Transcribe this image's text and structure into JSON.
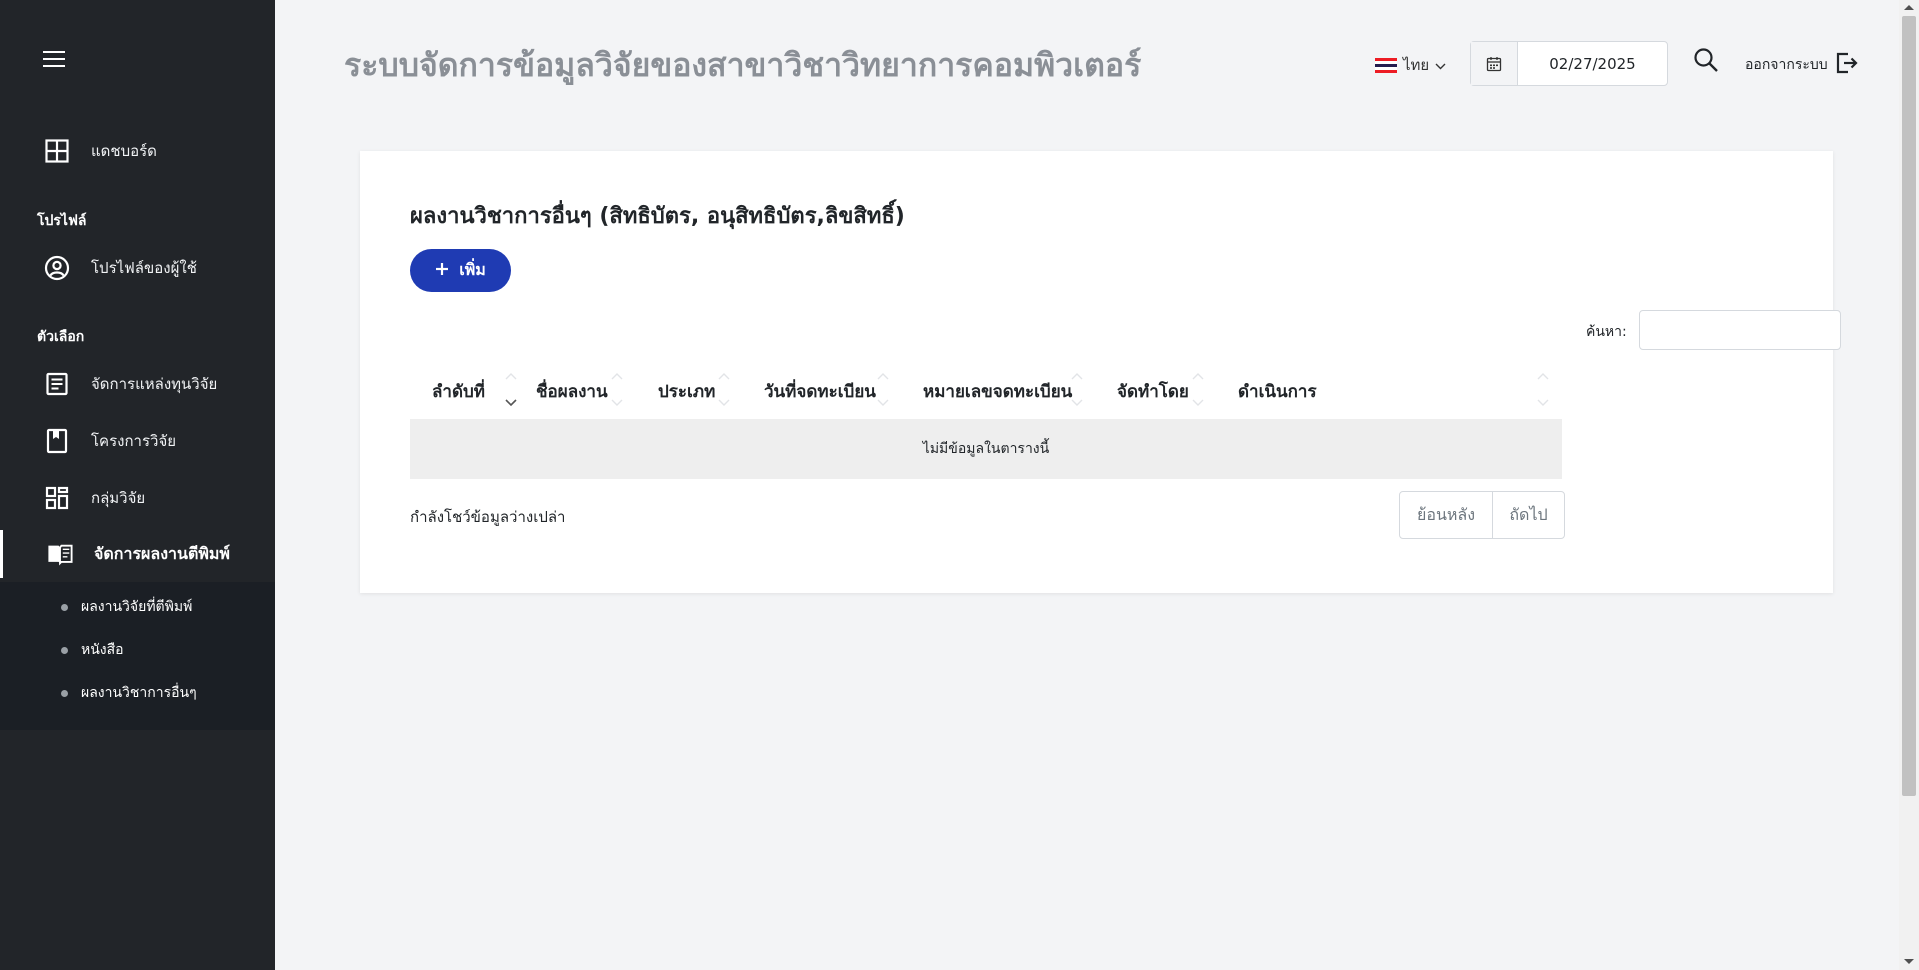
{
  "app": {
    "title": "ระบบจัดการข้อมูลวิจัยของสาขาวิชาวิทยาการคอมพิวเตอร์"
  },
  "header": {
    "language": "ไทย",
    "date": "02/27/2025",
    "logout_label": "ออกจากระบบ"
  },
  "sidebar": {
    "dashboard": "แดชบอร์ด",
    "section_profile": "โปรไฟล์",
    "user_profile": "โปรไฟล์ของผู้ใช้",
    "section_options": "ตัวเลือก",
    "items": [
      {
        "label": "จัดการแหล่งทุนวิจัย",
        "icon": "document-icon"
      },
      {
        "label": "โครงการวิจัย",
        "icon": "book-icon"
      },
      {
        "label": "กลุ่มวิจัย",
        "icon": "grid-icon"
      },
      {
        "label": "จัดการผลงานตีพิมพ์",
        "icon": "open-book-icon"
      }
    ],
    "submenu": [
      "ผลงานวิจัยที่ตีพิมพ์",
      "หนังสือ",
      "ผลงานวิชาการอื่นๆ"
    ]
  },
  "card": {
    "title": "ผลงานวิชาการอื่นๆ (สิทธิบัตร, อนุสิทธิบัตร,ลิขสิทธิ์)",
    "add_button": "เพิ่ม",
    "search_label": "ค้นหา:",
    "search_value": "",
    "columns": [
      "ลำดับที่",
      "ชื่อผลงาน",
      "ประเภท",
      "วันที่จดทะเบียน",
      "หมายเลขจดทะเบียน",
      "จัดทำโดย",
      "ดำเนินการ"
    ],
    "empty_message": "ไม่มีข้อมูลในตารางนี้",
    "info_text": "กำลังโชว์ข้อมูลว่างเปล่า",
    "prev_label": "ย้อนหลัง",
    "next_label": "ถัดไป"
  },
  "colors": {
    "sidebar_bg": "#222529",
    "primary": "#1f3bb3",
    "main_bg": "#f3f4f6"
  }
}
